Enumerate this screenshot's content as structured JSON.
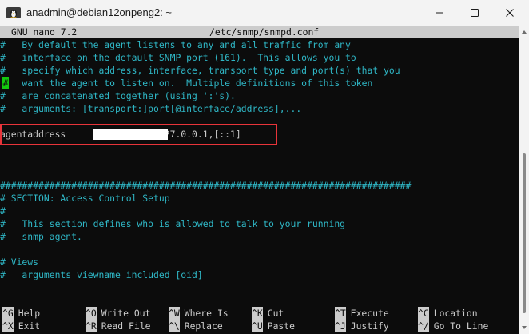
{
  "window": {
    "title": "anadmin@debian12onpeng2: ~",
    "icon": "terminal-penguin-icon"
  },
  "nano": {
    "version": "GNU nano 7.2",
    "filename": "/etc/snmp/snmpd.conf"
  },
  "lines": [
    {
      "row": 1,
      "text": "#   By default the agent listens to any and all traffic from any"
    },
    {
      "row": 2,
      "text": "#   interface on the default SNMP port (161).  This allows you to"
    },
    {
      "row": 3,
      "text": "#   specify which address, interface, transport type and port(s) that you"
    },
    {
      "row": 4,
      "text": "    want the agent to listen on.  Multiple definitions of this token"
    },
    {
      "row": 5,
      "text": "#   are concatenated together (using ':'s)."
    },
    {
      "row": 6,
      "text": "#   arguments: [transport:]port[@interface/address],..."
    },
    {
      "row": 8,
      "text": "agentaddress                ,127.0.0.1,[::1]"
    },
    {
      "row": 12,
      "text": "###########################################################################"
    },
    {
      "row": 13,
      "text": "# SECTION: Access Control Setup"
    },
    {
      "row": 14,
      "text": "#"
    },
    {
      "row": 15,
      "text": "#   This section defines who is allowed to talk to your running"
    },
    {
      "row": 16,
      "text": "#   snmp agent."
    },
    {
      "row": 18,
      "text": "# Views"
    },
    {
      "row": 19,
      "text": "#   arguments viewname included [oid]"
    }
  ],
  "cursor_char": "#",
  "shortcuts": [
    {
      "key": "^G",
      "label": "Help",
      "row": 0,
      "col": 0
    },
    {
      "key": "^O",
      "label": "Write Out",
      "row": 0,
      "col": 1
    },
    {
      "key": "^W",
      "label": "Where Is",
      "row": 0,
      "col": 2
    },
    {
      "key": "^K",
      "label": "Cut",
      "row": 0,
      "col": 3
    },
    {
      "key": "^T",
      "label": "Execute",
      "row": 0,
      "col": 4
    },
    {
      "key": "^C",
      "label": "Location",
      "row": 0,
      "col": 5
    },
    {
      "key": "^X",
      "label": "Exit",
      "row": 1,
      "col": 0
    },
    {
      "key": "^R",
      "label": "Read File",
      "row": 1,
      "col": 1
    },
    {
      "key": "^\\",
      "label": "Replace",
      "row": 1,
      "col": 2
    },
    {
      "key": "^U",
      "label": "Paste",
      "row": 1,
      "col": 3
    },
    {
      "key": "^J",
      "label": "Justify",
      "row": 1,
      "col": 4
    },
    {
      "key": "^/",
      "label": "Go To Line",
      "row": 1,
      "col": 5
    }
  ],
  "colors": {
    "terminal_bg": "#0c0c0c",
    "comment_text": "#2fb7c6",
    "plain_text": "#cccccc",
    "cursor": "#13c90e",
    "highlight_border": "#e8343a"
  }
}
